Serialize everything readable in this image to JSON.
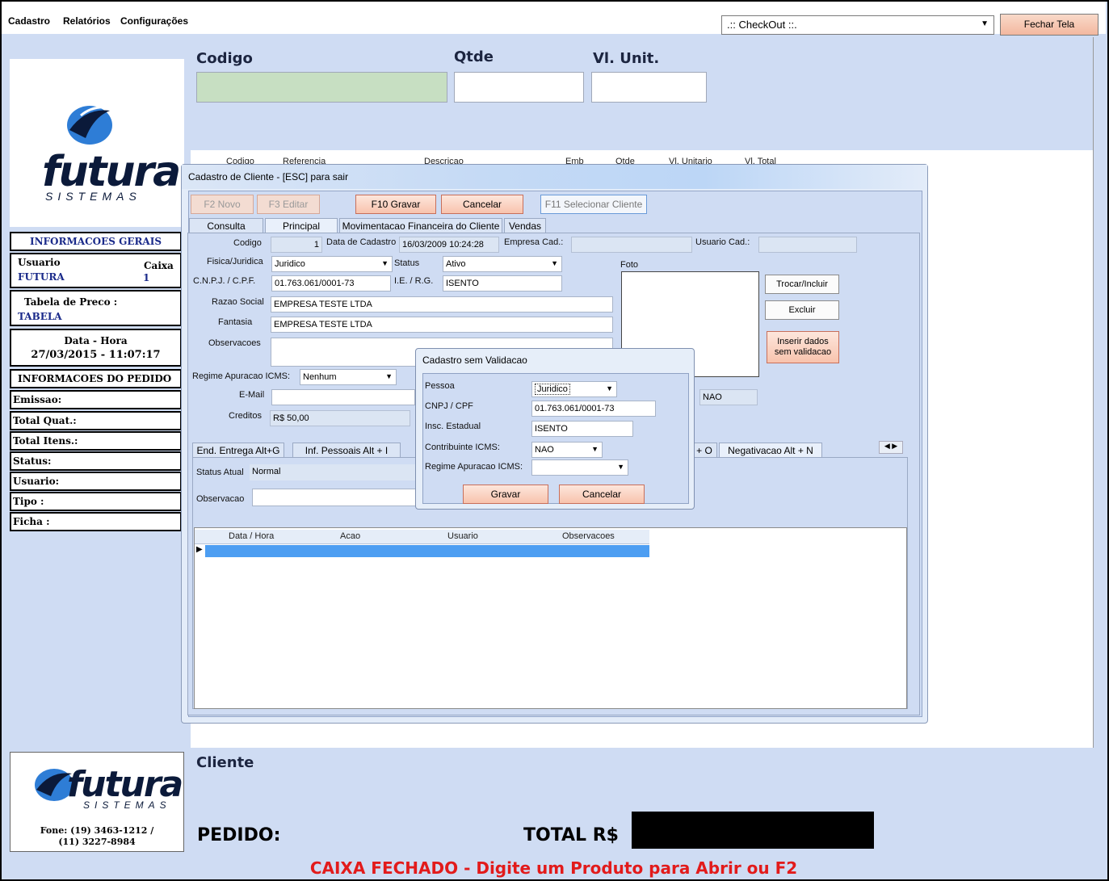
{
  "menu": [
    "Cadastro",
    "Relatórios",
    "Configurações"
  ],
  "checkout_select": ".:: CheckOut ::.",
  "fechar_label": "Fechar Tela",
  "logo": {
    "brand": "futura",
    "sub": "SISTEMAS"
  },
  "sidebar": {
    "info_gerais": "INFORMACOES GERAIS",
    "usuario_label": "Usuario",
    "usuario_value": "FUTURA",
    "caixa_label": "Caixa",
    "caixa_value": "1",
    "tabela_label": "Tabela de Preco :",
    "tabela_value": "TABELA",
    "datahora_label": "Data - Hora",
    "datahora_value": "27/03/2015 - 11:07:17",
    "info_pedido": "INFORMACOES DO PEDIDO",
    "pedido_fields": [
      "Emissao:",
      "Total Quat.:",
      "Total Itens.:",
      "Status:",
      "Usuario:",
      "Tipo :",
      "Ficha :"
    ],
    "fone": "Fone: (19) 3463-1212 /",
    "fone2": "(11) 3227-8984"
  },
  "top": {
    "codigo": "Codigo",
    "qtde": "Qtde",
    "vl_unit": "Vl. Unit."
  },
  "grid_headers": [
    "Codigo",
    "Referencia",
    "Descricao",
    "Emb",
    "Qtde",
    "Vl. Unitario",
    "Vl. Total"
  ],
  "bottom": {
    "cliente": "Cliente",
    "pedido": "PEDIDO:",
    "total": "TOTAL R$"
  },
  "status_message": "CAIXA FECHADO - Digite um Produto para Abrir ou F2",
  "cliente_window": {
    "title": "Cadastro de Cliente - [ESC] para sair",
    "buttons": {
      "novo": "F2 Novo",
      "editar": "F3 Editar",
      "gravar": "F10 Gravar",
      "cancelar": "Cancelar",
      "selecionar": "F11 Selecionar Cliente"
    },
    "tabs": [
      "Consulta",
      "Principal",
      "Movimentacao Financeira do Cliente",
      "Vendas"
    ],
    "labels": {
      "codigo": "Codigo",
      "data_cadastro": "Data de Cadastro",
      "empresa_cad": "Empresa Cad.:",
      "usuario_cad": "Usuario Cad.:",
      "fisica_juridica": "Fisica/Juridica",
      "status": "Status",
      "foto": "Foto",
      "cnpj": "C.N.P.J. / C.P.F.",
      "ie": "I.E. / R.G.",
      "razao": "Razao Social",
      "fantasia": "Fantasia",
      "obs": "Observacoes",
      "regime": "Regime Apuracao ICMS:",
      "email": "E-Mail",
      "creditos": "Creditos"
    },
    "values": {
      "codigo": "1",
      "data_cadastro": "16/03/2009 10:24:28",
      "fisica_juridica": "Juridico",
      "status": "Ativo",
      "cnpj": "01.763.061/0001-73",
      "ie": "ISENTO",
      "razao": "EMPRESA TESTE LTDA",
      "fantasia": "EMPRESA TESTE LTDA",
      "regime": "Nenhum",
      "creditos": "R$ 50,00",
      "nao": "NAO"
    },
    "side_buttons": {
      "trocar": "Trocar/Incluir",
      "excluir": "Excluir",
      "inserir1": "Inserir dados",
      "inserir2": "sem validacao"
    },
    "sub_tabs": [
      "End. Entrega Alt+G",
      "Inf. Pessoais Alt + I",
      "+ O",
      "Negativacao Alt + N"
    ],
    "status_atual_label": "Status Atual",
    "status_atual_value": "Normal",
    "observacao_label": "Observacao",
    "hist_headers": [
      "Data / Hora",
      "Acao",
      "Usuario",
      "Observacoes"
    ]
  },
  "dialog": {
    "title": "Cadastro sem Validacao",
    "pessoa_label": "Pessoa",
    "pessoa_value": "Juridico",
    "cnpj_label": "CNPJ / CPF",
    "cnpj_value": "01.763.061/0001-73",
    "insc_label": "Insc. Estadual",
    "insc_value": "ISENTO",
    "contrib_label": "Contribuinte ICMS:",
    "contrib_value": "NAO",
    "regime_label": "Regime Apuracao ICMS:",
    "regime_value": "",
    "gravar": "Gravar",
    "cancelar": "Cancelar"
  }
}
